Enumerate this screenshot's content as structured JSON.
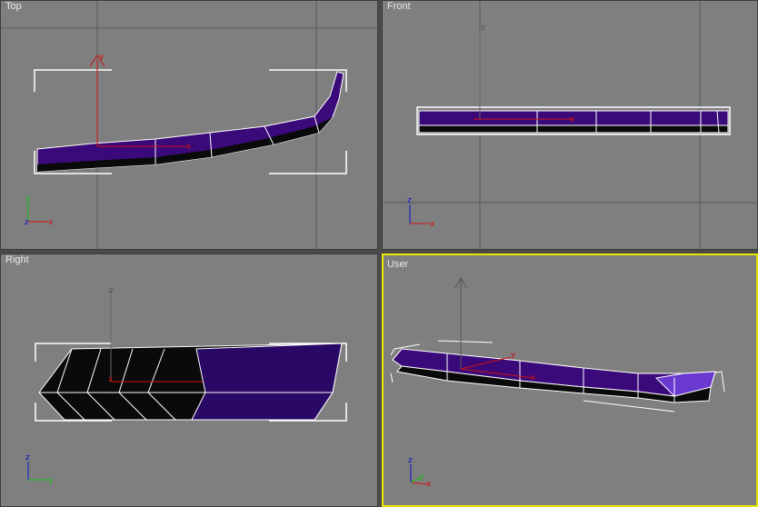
{
  "viewports": {
    "top": {
      "label": "Top"
    },
    "front": {
      "label": "Front"
    },
    "right": {
      "label": "Right"
    },
    "user": {
      "label": "User",
      "active": true
    }
  },
  "axes": {
    "x": "x",
    "y": "y",
    "z": "z"
  },
  "colors": {
    "viewport_bg": "#7f7f7f",
    "grid": "#5a5a5a",
    "object_fill": "#3a0a7a",
    "object_dark": "#0a0a0a",
    "selection_bracket": "#ffffff",
    "gizmo_red": "#d01010",
    "gizmo_green": "#10c010",
    "gizmo_blue": "#1010d0",
    "active_border": "#e6e600"
  }
}
